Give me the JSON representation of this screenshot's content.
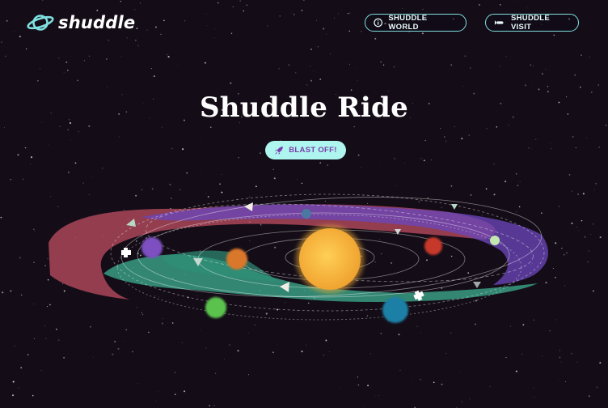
{
  "header": {
    "logo_text": "shuddle",
    "nav": [
      {
        "label": "SHUDDLE WORLD",
        "icon": "info-circle-icon"
      },
      {
        "label": "SHUDDLE VISIT",
        "icon": "shuttle-icon"
      }
    ]
  },
  "hero": {
    "title": "Shuddle Ride",
    "cta_label": "BLAST OFF!",
    "cta_icon": "rocket-icon"
  },
  "colors": {
    "background": "#120b14",
    "accent_cyan": "#7fe0e0",
    "cta_bg": "#aef5f0",
    "cta_text": "#7a3fa8",
    "sun": "#f5b13a",
    "band_red": "#b0485c",
    "band_purple": "#6a46b8",
    "band_green": "#3aa58a"
  }
}
